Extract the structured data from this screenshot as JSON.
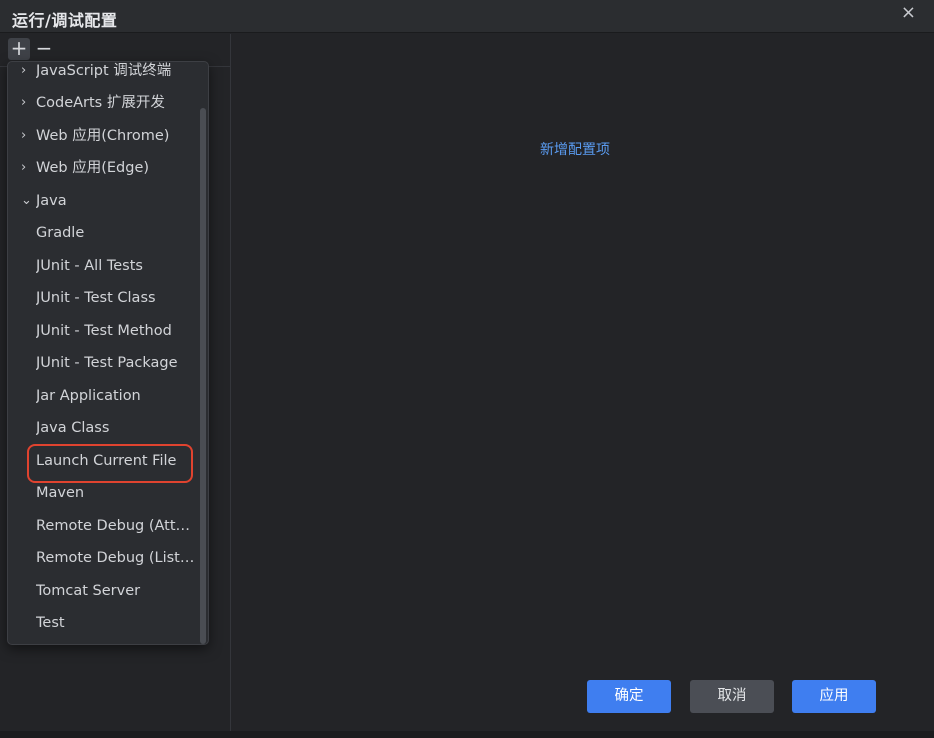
{
  "dialog": {
    "title": "运行/调试配置",
    "close_glyph": "×"
  },
  "toolbar": {
    "add_glyph": "+",
    "remove_glyph": "−"
  },
  "dropdown": {
    "items": [
      {
        "label": "JavaScript 调试终端",
        "chevron": "›",
        "expanded": false
      },
      {
        "label": "CodeArts 扩展开发",
        "chevron": "›",
        "expanded": false
      },
      {
        "label": "Web 应用(Chrome)",
        "chevron": "›",
        "expanded": false
      },
      {
        "label": "Web 应用(Edge)",
        "chevron": "›",
        "expanded": false
      },
      {
        "label": "Java",
        "chevron": "⌄",
        "expanded": true
      },
      {
        "label": "Gradle",
        "chevron": "",
        "expanded": false
      },
      {
        "label": "JUnit - All Tests",
        "chevron": "",
        "expanded": false
      },
      {
        "label": "JUnit - Test Class",
        "chevron": "",
        "expanded": false
      },
      {
        "label": "JUnit - Test Method",
        "chevron": "",
        "expanded": false
      },
      {
        "label": "JUnit - Test Package",
        "chevron": "",
        "expanded": false
      },
      {
        "label": "Jar Application",
        "chevron": "",
        "expanded": false
      },
      {
        "label": "Java Class",
        "chevron": "",
        "expanded": false
      },
      {
        "label": "Launch Current File",
        "chevron": "",
        "expanded": false,
        "highlighted": true
      },
      {
        "label": "Maven",
        "chevron": "",
        "expanded": false
      },
      {
        "label": "Remote Debug (Atta…",
        "chevron": "",
        "expanded": false
      },
      {
        "label": "Remote Debug (List…",
        "chevron": "",
        "expanded": false
      },
      {
        "label": "Tomcat Server",
        "chevron": "",
        "expanded": false
      },
      {
        "label": "Test",
        "chevron": "",
        "expanded": false
      }
    ]
  },
  "main": {
    "add_config_link": "新增配置项"
  },
  "buttons": {
    "ok": "确定",
    "cancel": "取消",
    "apply": "应用"
  },
  "colors": {
    "accent": "#3f7ef0",
    "link": "#5a9bf0",
    "highlight_border": "#e0432f",
    "background": "#232427"
  }
}
